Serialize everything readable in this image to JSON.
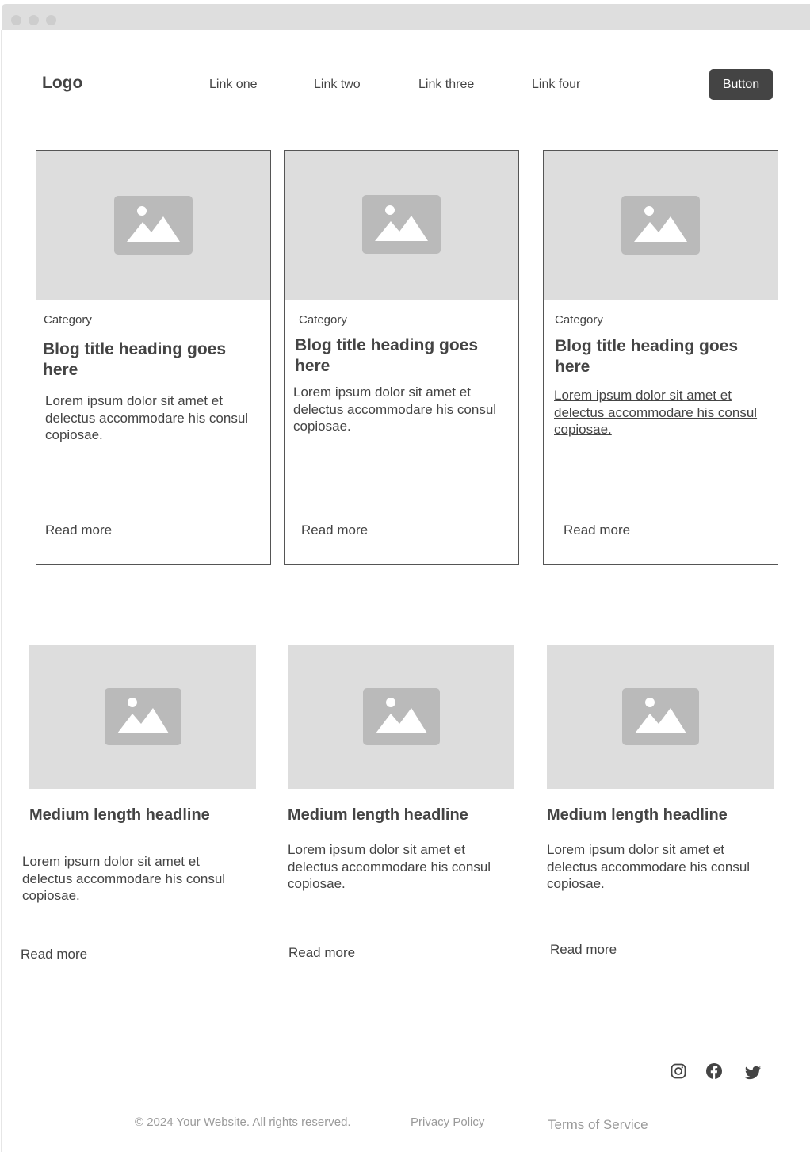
{
  "header": {
    "logo": "Logo",
    "nav": [
      "Link one",
      "Link two",
      "Link three",
      "Link four"
    ],
    "button": "Button"
  },
  "blog_cards": [
    {
      "category": "Category",
      "title": "Blog title heading goes here",
      "body": "Lorem ipsum dolor sit amet et delectus accommodare his consul copiosae.",
      "link": "Read more",
      "image_icon": "image-placeholder-icon"
    },
    {
      "category": "Category",
      "title": "Blog title heading goes here",
      "body": "Lorem ipsum dolor sit amet et delectus accommodare his consul copiosae.",
      "link": "Read more",
      "image_icon": "image-placeholder-icon"
    },
    {
      "category": "Category",
      "title": "Blog title heading goes here",
      "body": "Lorem ipsum dolor sit amet et delectus accommodare his consul copiosae.",
      "link": "Read more",
      "image_icon": "image-placeholder-icon"
    }
  ],
  "media_cards": [
    {
      "title": "Medium length headline",
      "body": "Lorem ipsum dolor sit amet et delectus accommodare his consul copiosae.",
      "link": "Read more",
      "image_icon": "image-placeholder-icon"
    },
    {
      "title": "Medium length headline",
      "body": "Lorem ipsum dolor sit amet et delectus accommodare his consul copiosae.",
      "link": "Read more",
      "image_icon": "image-placeholder-icon"
    },
    {
      "title": "Medium length headline",
      "body": "Lorem ipsum dolor sit amet et delectus accommodare his consul copiosae.",
      "link": "Read more",
      "image_icon": "image-placeholder-icon"
    }
  ],
  "footer": {
    "copyright": "© 2024 Your Website. All rights reserved.",
    "privacy": "Privacy Policy",
    "terms": "Terms of Service",
    "social_icons": [
      "instagram-icon",
      "facebook-icon",
      "twitter-icon"
    ]
  },
  "colors": {
    "text": "#444444",
    "button_bg": "#444444",
    "button_text": "#ffffff",
    "placeholder_bg": "#dddddd",
    "placeholder_icon": "#bababa",
    "footer_text": "#9a9a9a"
  }
}
